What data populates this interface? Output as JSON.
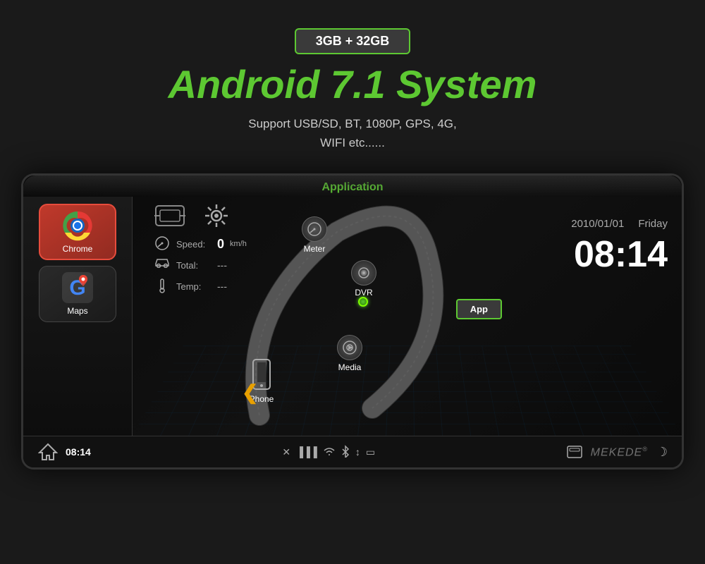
{
  "badge": {
    "text": "3GB + 32GB"
  },
  "header": {
    "title": "Android 7.1 System",
    "subtitle_line1": "Support USB/SD,  BT,  1080P,  GPS,  4G,",
    "subtitle_line2": "WIFI etc......"
  },
  "screen": {
    "app_title": "Application",
    "left_sidebar": {
      "apps": [
        {
          "name": "Chrome",
          "type": "chrome"
        },
        {
          "name": "Maps",
          "type": "maps"
        }
      ]
    },
    "dashboard": {
      "speed_label": "Speed:",
      "speed_value": "0",
      "speed_unit": "km/h",
      "total_label": "Total:",
      "total_value": "---",
      "temp_label": "Temp:",
      "temp_value": "---"
    },
    "arc_menu": [
      {
        "id": "meter",
        "label": "Meter"
      },
      {
        "id": "dvr",
        "label": "DVR"
      },
      {
        "id": "app",
        "label": "App"
      },
      {
        "id": "media",
        "label": "Media"
      },
      {
        "id": "phone",
        "label": "Phone"
      }
    ],
    "datetime": {
      "date": "2010/01/01",
      "day": "Friday",
      "time": "08:14"
    },
    "bottom_bar": {
      "time": "08:14",
      "brand": "MEKEDE",
      "reg": "®"
    },
    "back_arrow": "❮"
  }
}
